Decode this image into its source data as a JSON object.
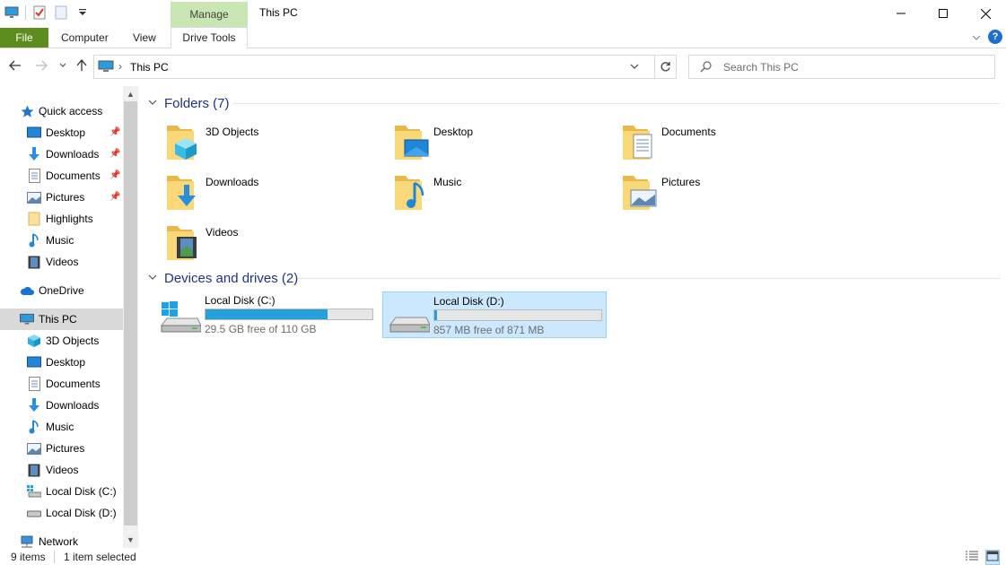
{
  "window": {
    "title": "This PC",
    "contextual_tab": "Manage",
    "controls": [
      "minimize",
      "maximize",
      "close"
    ]
  },
  "ribbon": {
    "tabs": [
      "File",
      "Computer",
      "View",
      "Drive Tools"
    ],
    "help_label": "?",
    "colors": {
      "file_tab": "#5c8d1d",
      "manage_tab": "#c8e6b4",
      "accent": "#26a0da"
    }
  },
  "address_bar": {
    "path": "This PC",
    "search_placeholder": "Search This PC"
  },
  "sidebar": {
    "quick_access": {
      "label": "Quick access",
      "items": [
        {
          "label": "Desktop",
          "icon": "desktop-icon",
          "pinned": true
        },
        {
          "label": "Downloads",
          "icon": "downloads-icon",
          "pinned": true
        },
        {
          "label": "Documents",
          "icon": "documents-icon",
          "pinned": true
        },
        {
          "label": "Pictures",
          "icon": "pictures-icon",
          "pinned": true
        },
        {
          "label": "Highlights",
          "icon": "folder-icon",
          "pinned": false
        },
        {
          "label": "Music",
          "icon": "music-icon",
          "pinned": false
        },
        {
          "label": "Videos",
          "icon": "videos-icon",
          "pinned": false
        }
      ]
    },
    "onedrive": {
      "label": "OneDrive"
    },
    "this_pc": {
      "label": "This PC",
      "selected": true,
      "items": [
        {
          "label": "3D Objects",
          "icon": "3d-objects-icon"
        },
        {
          "label": "Desktop",
          "icon": "desktop-icon"
        },
        {
          "label": "Documents",
          "icon": "documents-icon"
        },
        {
          "label": "Downloads",
          "icon": "downloads-icon"
        },
        {
          "label": "Music",
          "icon": "music-icon"
        },
        {
          "label": "Pictures",
          "icon": "pictures-icon"
        },
        {
          "label": "Videos",
          "icon": "videos-icon"
        },
        {
          "label": "Local Disk (C:)",
          "icon": "windows-drive-icon"
        },
        {
          "label": "Local Disk (D:)",
          "icon": "drive-icon"
        }
      ]
    },
    "network": {
      "label": "Network"
    }
  },
  "content": {
    "folders": {
      "heading": "Folders (7)",
      "items": [
        {
          "label": "3D Objects",
          "icon": "3d-objects-icon"
        },
        {
          "label": "Desktop",
          "icon": "desktop-icon"
        },
        {
          "label": "Documents",
          "icon": "documents-icon"
        },
        {
          "label": "Downloads",
          "icon": "downloads-icon"
        },
        {
          "label": "Music",
          "icon": "music-icon"
        },
        {
          "label": "Pictures",
          "icon": "pictures-icon"
        },
        {
          "label": "Videos",
          "icon": "videos-icon"
        }
      ]
    },
    "drives": {
      "heading": "Devices and drives (2)",
      "items": [
        {
          "label": "Local Disk (C:)",
          "free_text": "29.5 GB free of 110 GB",
          "used_fraction": 0.732,
          "selected": false,
          "icon": "windows-drive-icon"
        },
        {
          "label": "Local Disk (D:)",
          "free_text": "857 MB free of 871 MB",
          "used_fraction": 0.016,
          "selected": true,
          "icon": "drive-icon"
        }
      ]
    }
  },
  "status_bar": {
    "item_count": "9 items",
    "selection": "1 item selected",
    "views": [
      "details-view",
      "large-icons-view"
    ]
  }
}
